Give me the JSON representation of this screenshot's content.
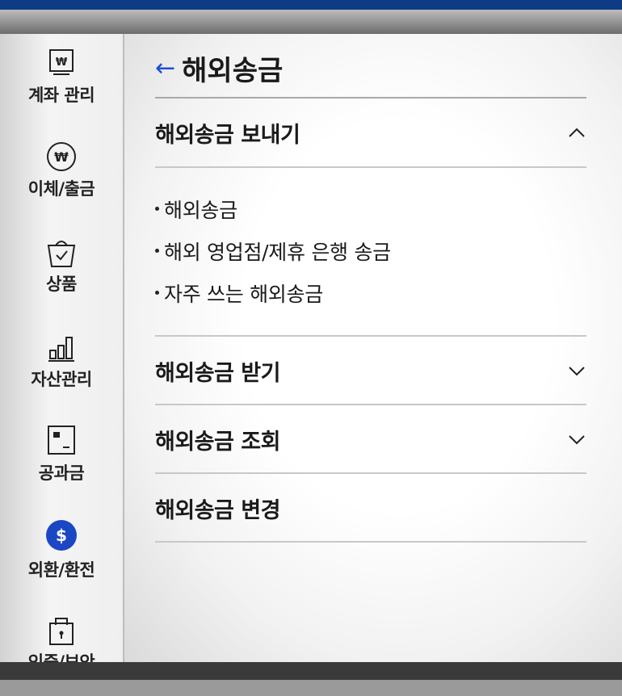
{
  "sidebar": {
    "items": [
      {
        "label": "계좌 관리",
        "icon": "account-won-icon"
      },
      {
        "label": "이체/출금",
        "icon": "won-circle-icon"
      },
      {
        "label": "상품",
        "icon": "shopping-bag-icon"
      },
      {
        "label": "자산관리",
        "icon": "bar-chart-icon"
      },
      {
        "label": "공과금",
        "icon": "bill-icon"
      },
      {
        "label": "외환/환전",
        "icon": "dollar-circle-icon",
        "active": true
      },
      {
        "label": "인증/보안",
        "icon": "lock-icon"
      }
    ],
    "active_color": "#1b47c4"
  },
  "header": {
    "back_glyph": "←",
    "title": "해외송금"
  },
  "sections": [
    {
      "label": "해외송금 보내기",
      "expanded": true,
      "items": [
        "해외송금",
        "해외 영업점/제휴 은행 송금",
        "자주 쓰는 해외송금"
      ]
    },
    {
      "label": "해외송금 받기",
      "expanded": false
    },
    {
      "label": "해외송금 조회",
      "expanded": false
    },
    {
      "label": "해외송금 변경"
    }
  ],
  "colors": {
    "accent": "#1c4fd6",
    "topbar": "#0f3b86"
  }
}
